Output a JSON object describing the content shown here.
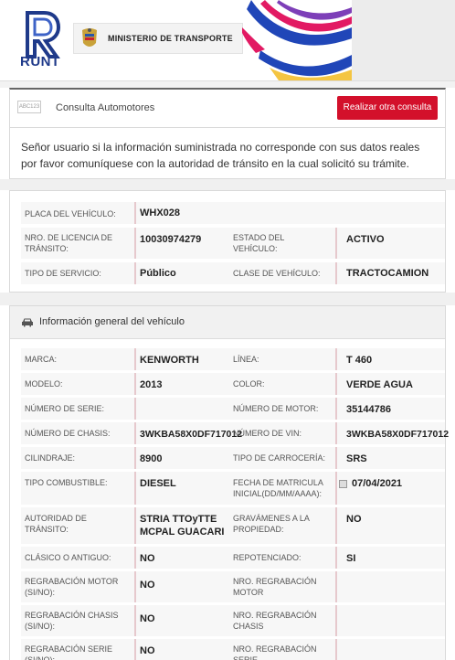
{
  "header": {
    "brand": "RUNT",
    "ministry": "MINISTERIO DE TRANSPORTE"
  },
  "consulta": {
    "icon_text": "ABC123",
    "title": "Consulta Automotores",
    "button": "Realizar otra consulta"
  },
  "notice": "Señor usuario si la información suministrada no corresponde con sus datos reales por favor comuníquese con la autoridad de tránsito en la cual solicitó su trámite.",
  "plate": {
    "placa_label": "PLACA DEL VEHÍCULO:",
    "placa": "WHX028",
    "licencia_label": "NRO. DE LICENCIA DE TRÁNSITO:",
    "licencia": "10030974279",
    "estado_label": "ESTADO DEL VEHÍCULO:",
    "estado": "ACTIVO",
    "servicio_label": "TIPO DE SERVICIO:",
    "servicio": "Público",
    "clase_label": "CLASE DE VEHÍCULO:",
    "clase": "TRACTOCAMION"
  },
  "info": {
    "title": "Información general del vehículo",
    "rows": [
      {
        "l1": "MARCA:",
        "v1": "KENWORTH",
        "l2": "LÍNEA:",
        "v2": "T 460"
      },
      {
        "l1": "MODELO:",
        "v1": "2013",
        "l2": "COLOR:",
        "v2": "VERDE AGUA"
      },
      {
        "l1": "NÚMERO DE SERIE:",
        "v1": "",
        "l2": "NÚMERO DE MOTOR:",
        "v2": "35144786"
      },
      {
        "l1": "NÚMERO DE CHASIS:",
        "v1": "3WKBA58X0DF717012",
        "l2": "NÚMERO DE VIN:",
        "v2": "3WKBA58X0DF717012"
      },
      {
        "l1": "CILINDRAJE:",
        "v1": "8900",
        "l2": "TIPO DE CARROCERÍA:",
        "v2": "SRS"
      },
      {
        "l1": "TIPO COMBUSTIBLE:",
        "v1": "DIESEL",
        "l2": "FECHA DE MATRICULA INICIAL(DD/MM/AAAA):",
        "v2": "07/04/2021"
      },
      {
        "l1": "AUTORIDAD DE TRÁNSITO:",
        "v1": "STRIA TTOyTTE MCPAL GUACARI",
        "l2": "GRAVÁMENES A LA PROPIEDAD:",
        "v2": "NO"
      },
      {
        "l1": "CLÁSICO O ANTIGUO:",
        "v1": "NO",
        "l2": "REPOTENCIADO:",
        "v2": "SI"
      },
      {
        "l1": "REGRABACIÓN MOTOR (SI/NO):",
        "v1": "NO",
        "l2": "NRO. REGRABACIÓN MOTOR",
        "v2": ""
      },
      {
        "l1": "REGRABACIÓN CHASIS (SI/NO):",
        "v1": "NO",
        "l2": "NRO. REGRABACIÓN CHASIS",
        "v2": ""
      },
      {
        "l1": "REGRABACIÓN SERIE (SI/NO):",
        "v1": "NO",
        "l2": "NRO. REGRABACIÓN SERIE",
        "v2": ""
      }
    ]
  },
  "colors": {
    "accent_red": "#d3102b",
    "runt_blue": "#1f3a8a"
  }
}
